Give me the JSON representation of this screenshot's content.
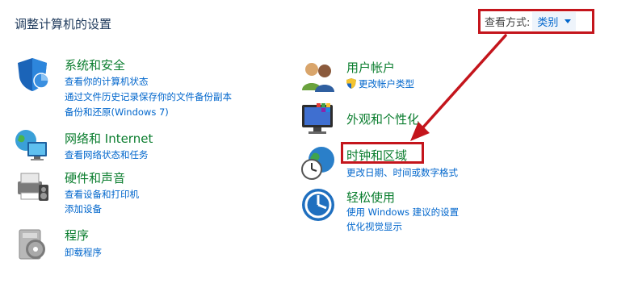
{
  "page": {
    "heading": "调整计算机的设置"
  },
  "view_by": {
    "label": "查看方式:",
    "value": "类别"
  },
  "categories": {
    "system_security": {
      "title": "系统和安全",
      "links": [
        "查看你的计算机状态",
        "通过文件历史记录保存你的文件备份副本",
        "备份和还原(Windows 7)"
      ]
    },
    "network_internet": {
      "title": "网络和 Internet",
      "links": [
        "查看网络状态和任务"
      ]
    },
    "hardware_sound": {
      "title": "硬件和声音",
      "links": [
        "查看设备和打印机",
        "添加设备"
      ]
    },
    "programs": {
      "title": "程序",
      "links": [
        "卸载程序"
      ]
    },
    "user_accounts": {
      "title": "用户帐户",
      "links": [
        "更改帐户类型"
      ]
    },
    "appearance": {
      "title": "外观和个性化",
      "links": []
    },
    "clock_region": {
      "title": "时钟和区域",
      "links": [
        "更改日期、时间或数字格式"
      ]
    },
    "ease_access": {
      "title": "轻松使用",
      "links": [
        "使用 Windows 建议的设置",
        "优化视觉显示"
      ]
    }
  },
  "annotation": {
    "color": "#c4151c"
  }
}
